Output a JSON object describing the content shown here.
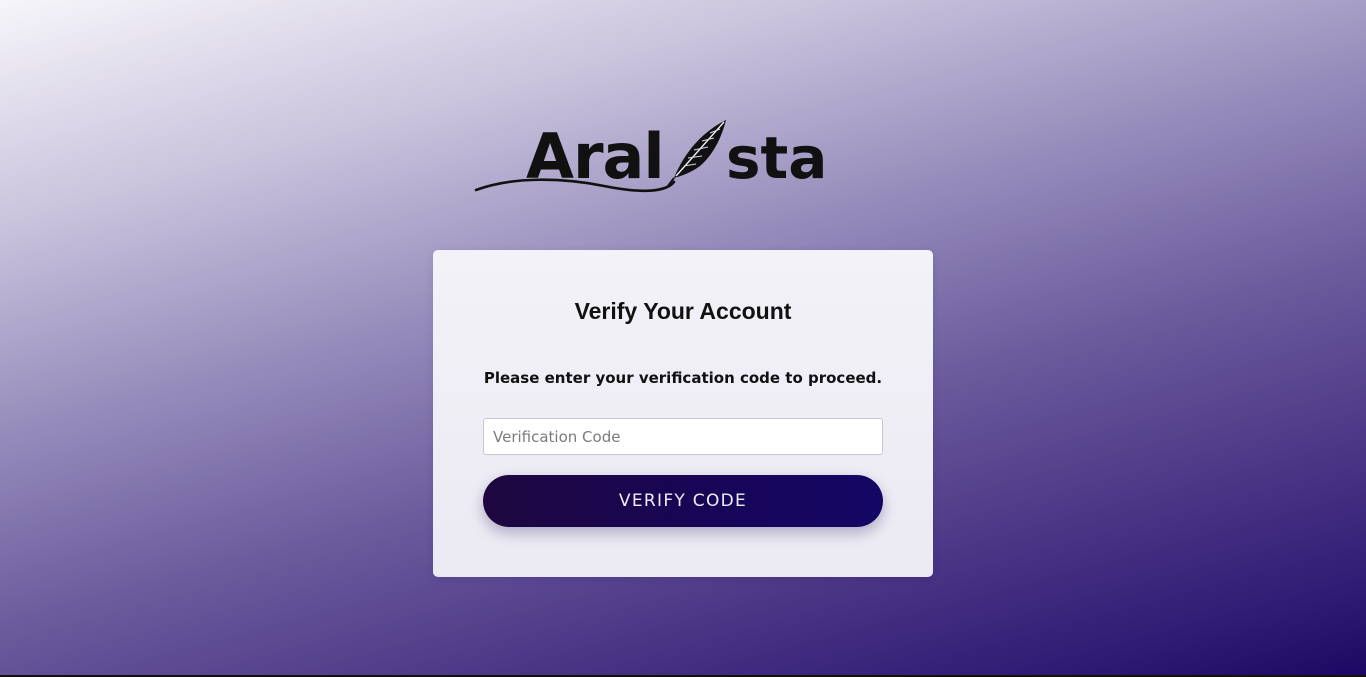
{
  "brand": {
    "name_left": "Aral",
    "name_right": "sta",
    "ink_color": "#111111",
    "icon": "feather-quill-icon"
  },
  "card": {
    "title": "Verify Your Account",
    "subtitle": "Please enter your verification code to proceed.",
    "code_input": {
      "value": "",
      "placeholder": "Verification Code"
    },
    "verify_button": {
      "label": "VERIFY CODE",
      "color": "#170558"
    }
  }
}
